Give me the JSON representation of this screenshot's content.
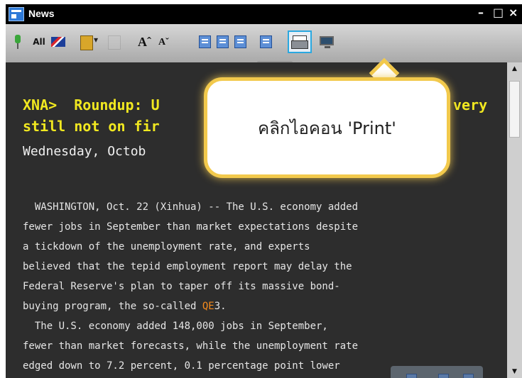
{
  "window": {
    "title": "News",
    "minimize": "–",
    "maximize": "□",
    "close": "×"
  },
  "toolbar": {
    "all_label": "All",
    "font_increase_label": "Aˆ",
    "font_decrease_label": "Aˇ",
    "icons": [
      "pin-icon",
      "flag-icon",
      "book-icon",
      "document-icon",
      "increase-font-icon",
      "decrease-font-icon",
      "fit-page-icon",
      "previous-story-icon",
      "next-story-icon",
      "copy-icon",
      "print-icon",
      "monitor-icon"
    ]
  },
  "article": {
    "headline_line1": "XNA>  Roundup: U",
    "headline_line1_tail": "very",
    "headline_line2": "still not on fir",
    "date": "Wednesday, Octob",
    "paragraphs": [
      "  WASHINGTON, Oct. 22 (Xinhua) -- The U.S. economy added",
      "fewer jobs in September than market expectations despite",
      "a tickdown of the unemployment rate, and experts",
      "believed that the tepid employment report may delay the",
      "Federal Reserve's plan to taper off its massive bond-",
      "buying program, the so-called ",
      "  The U.S. economy added 148,000 jobs in September,",
      "fewer than market forecasts, while the unemployment rate",
      "edged down to 7.2 percent, 0.1 percentage point lower"
    ],
    "qe_highlight": "QE",
    "qe_suffix": "3."
  },
  "callout": {
    "text": "คลิกไอคอน  'Print'"
  },
  "colors": {
    "headline": "#f1e820",
    "highlight": "#f58b1d",
    "callout_border": "#f2c94c",
    "print_highlight": "#2aa8e0"
  }
}
